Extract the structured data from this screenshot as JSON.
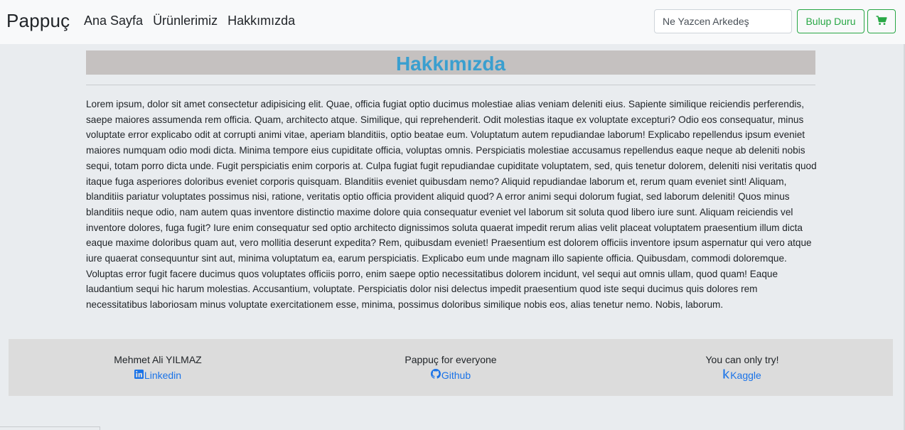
{
  "navbar": {
    "brand": "Pappuç",
    "links": [
      "Ana Sayfa",
      "Ürünlerimiz",
      "Hakkımızda"
    ],
    "search_placeholder": "Ne Yazcen Arkedeş",
    "search_button": "Bulup Duru",
    "cart_icon": "cart-icon"
  },
  "main": {
    "heading": "Hakkımızda",
    "paragraph": "Lorem ipsum, dolor sit amet consectetur adipisicing elit. Quae, officia fugiat optio ducimus molestiae alias veniam deleniti eius. Sapiente similique reiciendis perferendis, saepe maiores assumenda rem officia. Quam, architecto atque. Similique, qui reprehenderit. Odit molestias itaque ex voluptate excepturi? Odio eos consequatur, minus voluptate error explicabo odit at corrupti animi vitae, aperiam blanditiis, optio beatae eum. Voluptatum autem repudiandae laborum! Explicabo repellendus ipsum eveniet maiores numquam odio modi dicta. Minima tempore eius cupiditate officia, voluptas omnis. Perspiciatis molestiae accusamus repellendus eaque neque ab deleniti nobis sequi, totam porro dicta unde. Fugit perspiciatis enim corporis at. Culpa fugiat fugit repudiandae cupiditate voluptatem, sed, quis tenetur dolorem, deleniti nisi veritatis quod itaque fuga asperiores doloribus eveniet corporis quisquam. Blanditiis eveniet quibusdam nemo? Aliquid repudiandae laborum et, rerum quam eveniet sint! Aliquam, blanditiis pariatur voluptates possimus nisi, ratione, veritatis optio officia provident aliquid quod? A error animi sequi dolorum fugiat, sed laborum deleniti! Quos minus blanditiis neque odio, nam autem quas inventore distinctio maxime dolore quia consequatur eveniet vel laborum sit soluta quod libero iure sunt. Aliquam reiciendis vel inventore dolores, fuga fugit? Iure enim consequatur sed optio architecto dignissimos soluta quaerat impedit rerum alias velit placeat voluptatem praesentium illum dicta eaque maxime doloribus quam aut, vero mollitia deserunt expedita? Rem, quibusdam eveniet! Praesentium est dolorem officiis inventore ipsum aspernatur qui vero atque iure quaerat consequuntur sint aut, minima voluptatum ea, earum perspiciatis. Explicabo eum unde magnam illo sapiente officia. Quibusdam, commodi doloremque. Voluptas error fugit facere ducimus quos voluptates officiis porro, enim saepe optio necessitatibus dolorem incidunt, vel sequi aut omnis ullam, quod quam! Eaque laudantium sequi hic harum molestias. Accusantium, voluptate. Perspiciatis dolor nisi delectus impedit praesentium quod iste sequi ducimus quis dolores rem necessitatibus laboriosam minus voluptate exercitationem esse, minima, possimus doloribus similique nobis eos, alias tenetur nemo. Nobis, laborum."
  },
  "footer": {
    "columns": [
      {
        "title": "Mehmet Ali YILMAZ",
        "link": "Linkedin",
        "icon": "linkedin-icon"
      },
      {
        "title": "Pappuç for everyone",
        "link": "Github",
        "icon": "github-icon"
      },
      {
        "title": "You can only try!",
        "link": "Kaggle",
        "icon": "kaggle-icon"
      }
    ]
  },
  "colors": {
    "accent_heading": "#3a9fcf",
    "success": "#28a745",
    "link": "#1a73e8"
  }
}
